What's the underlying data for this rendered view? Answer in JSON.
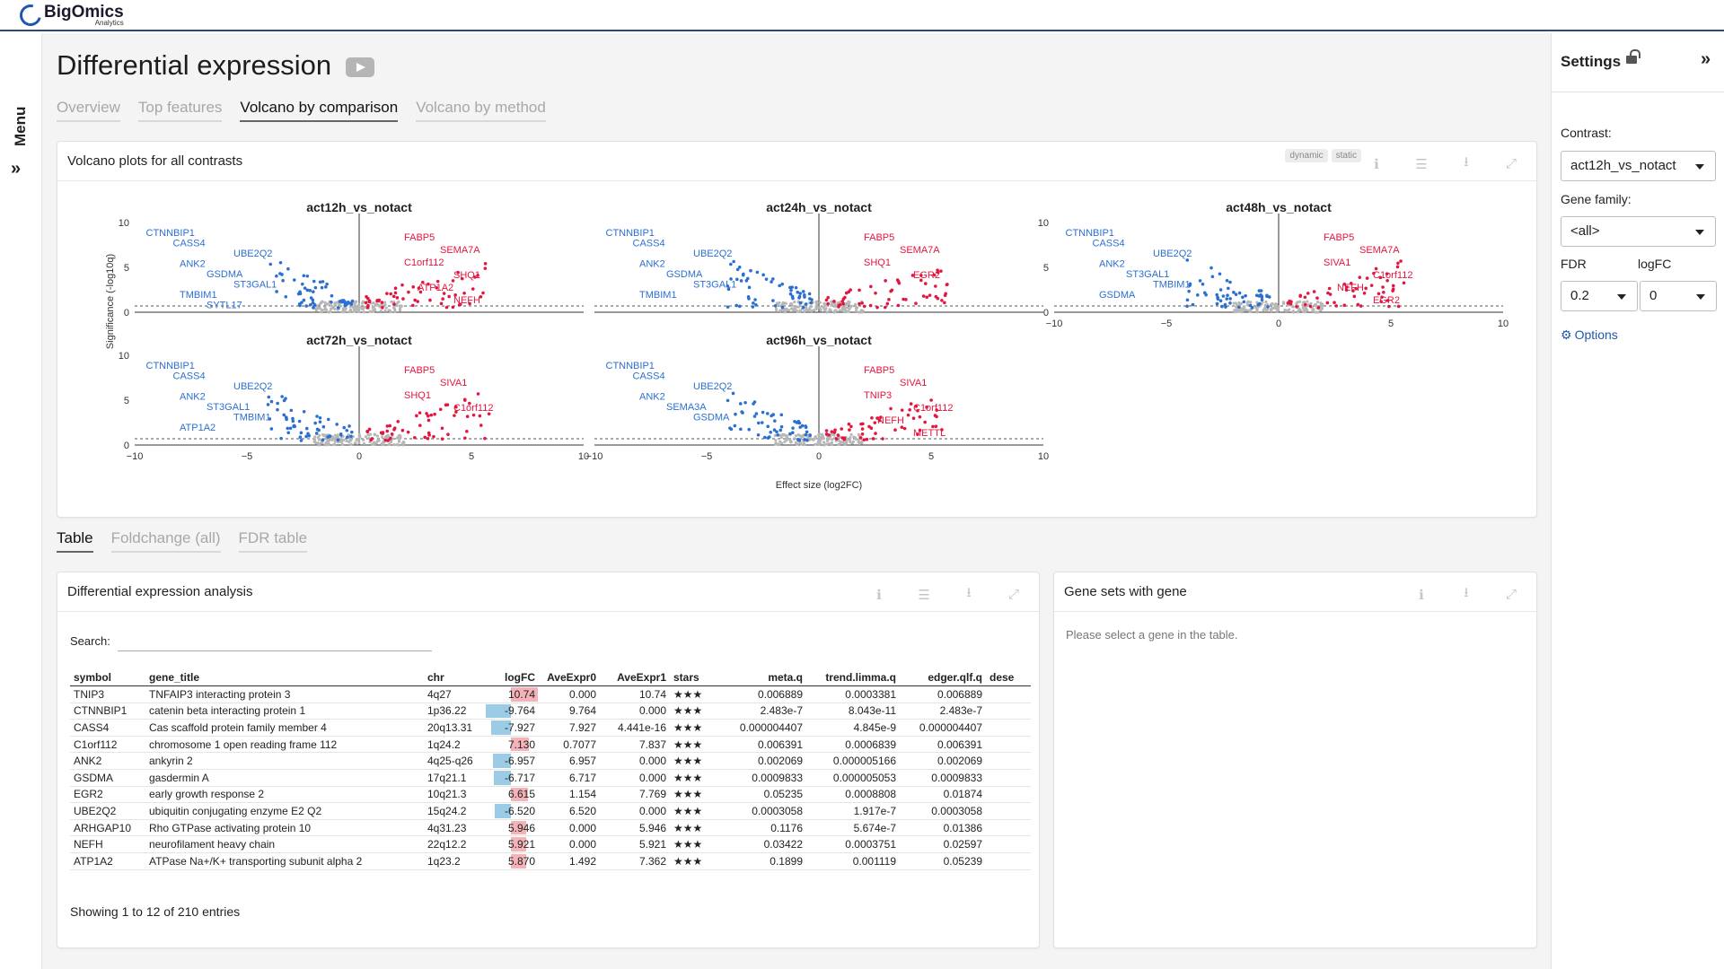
{
  "app": {
    "brand": "BigOmics",
    "brand_sub": "Analytics",
    "menu_label": "Menu"
  },
  "page": {
    "title": "Differential expression"
  },
  "tabs": [
    {
      "label": "Overview",
      "active": false
    },
    {
      "label": "Top features",
      "active": false
    },
    {
      "label": "Volcano by comparison",
      "active": true
    },
    {
      "label": "Volcano by method",
      "active": false
    }
  ],
  "volcano": {
    "title": "Volcano plots for all contrasts",
    "toggle": [
      "dynamic",
      "static"
    ],
    "ylabel": "Significance (-log10q)",
    "xlabel": "Effect size (log2FC)",
    "xticks": [
      "−10",
      "−5",
      "0",
      "5",
      "10"
    ],
    "yticks": [
      "0",
      "5",
      "10"
    ],
    "plots": [
      {
        "title": "act12h_vs_notact",
        "labels_left": [
          "CTNNBIP1",
          "CASS4",
          "UBE2Q2",
          "ANK2",
          "GSDMA",
          "ST3GAL1",
          "TMBIM1",
          "SYTL17"
        ],
        "labels_right": [
          "FABP5",
          "SEMA7A",
          "C1orf112",
          "SHQ1",
          "ATP1A2",
          "NEFH"
        ]
      },
      {
        "title": "act24h_vs_notact",
        "labels_left": [
          "CTNNBIP1",
          "CASS4",
          "UBE2Q2",
          "ANK2",
          "GSDMA",
          "ST3GAL1",
          "TMBIM1"
        ],
        "labels_right": [
          "FABP5",
          "SEMA7A",
          "SHQ1",
          "EGR2"
        ]
      },
      {
        "title": "act48h_vs_notact",
        "labels_left": [
          "CTNNBIP1",
          "CASS4",
          "UBE2Q2",
          "ANK2",
          "ST3GAL1",
          "TMBIM1",
          "GSDMA"
        ],
        "labels_right": [
          "FABP5",
          "SEMA7A",
          "SIVA1",
          "C1orf112",
          "NEFH",
          "EGR2"
        ]
      },
      {
        "title": "act72h_vs_notact",
        "labels_left": [
          "CTNNBIP1",
          "CASS4",
          "UBE2Q2",
          "ANK2",
          "ST3GAL1",
          "TMBIM1",
          "ATP1A2"
        ],
        "labels_right": [
          "FABP5",
          "SIVA1",
          "SHQ1",
          "C1orf112"
        ]
      },
      {
        "title": "act96h_vs_notact",
        "labels_left": [
          "CTNNBIP1",
          "CASS4",
          "UBE2Q2",
          "ANK2",
          "SEMA3A",
          "GSDMA"
        ],
        "labels_right": [
          "FABP5",
          "SIVA1",
          "TNIP3",
          "C1orf112",
          "NEFH",
          "METTL"
        ]
      }
    ]
  },
  "subtabs": [
    {
      "label": "Table",
      "active": true
    },
    {
      "label": "Foldchange (all)",
      "active": false
    },
    {
      "label": "FDR table",
      "active": false
    }
  ],
  "de_table": {
    "title": "Differential expression analysis",
    "search_label": "Search:",
    "search_value": "",
    "columns": [
      "symbol",
      "gene_title",
      "chr",
      "logFC",
      "AveExpr0",
      "AveExpr1",
      "stars",
      "meta.q",
      "trend.limma.q",
      "edger.qlf.q",
      "dese"
    ],
    "rows": [
      [
        "TNIP3",
        "TNFAIP3 interacting protein 3",
        "4q27",
        "10.74",
        "0.000",
        "10.74",
        "★★★",
        "0.006889",
        "0.0003381",
        "0.006889"
      ],
      [
        "CTNNBIP1",
        "catenin beta interacting protein 1",
        "1p36.22",
        "-9.764",
        "9.764",
        "0.000",
        "★★★",
        "2.483e-7",
        "8.043e-11",
        "2.483e-7"
      ],
      [
        "CASS4",
        "Cas scaffold protein family member 4",
        "20q13.31",
        "-7.927",
        "7.927",
        "4.441e-16",
        "★★★",
        "0.000004407",
        "4.845e-9",
        "0.000004407"
      ],
      [
        "C1orf112",
        "chromosome 1 open reading frame 112",
        "1q24.2",
        "7.130",
        "0.7077",
        "7.837",
        "★★★",
        "0.006391",
        "0.0006839",
        "0.006391"
      ],
      [
        "ANK2",
        "ankyrin 2",
        "4q25-q26",
        "-6.957",
        "6.957",
        "0.000",
        "★★★",
        "0.002069",
        "0.000005166",
        "0.002069"
      ],
      [
        "GSDMA",
        "gasdermin A",
        "17q21.1",
        "-6.717",
        "6.717",
        "0.000",
        "★★★",
        "0.0009833",
        "0.000005053",
        "0.0009833"
      ],
      [
        "EGR2",
        "early growth response 2",
        "10q21.3",
        "6.615",
        "1.154",
        "7.769",
        "★★★",
        "0.05235",
        "0.0008808",
        "0.01874"
      ],
      [
        "UBE2Q2",
        "ubiquitin conjugating enzyme E2 Q2",
        "15q24.2",
        "-6.520",
        "6.520",
        "0.000",
        "★★★",
        "0.0003058",
        "1.917e-7",
        "0.0003058"
      ],
      [
        "ARHGAP10",
        "Rho GTPase activating protein 10",
        "4q31.23",
        "5.946",
        "0.000",
        "5.946",
        "★★★",
        "0.1176",
        "5.674e-7",
        "0.01386"
      ],
      [
        "NEFH",
        "neurofilament heavy chain",
        "22q12.2",
        "5.921",
        "0.000",
        "5.921",
        "★★★",
        "0.03422",
        "0.0003751",
        "0.02597"
      ],
      [
        "ATP1A2",
        "ATPase Na+/K+ transporting subunit alpha 2",
        "1q23.2",
        "5.870",
        "1.492",
        "7.362",
        "★★★",
        "0.1899",
        "0.001119",
        "0.05239"
      ]
    ],
    "info": "Showing 1 to 12 of 210 entries"
  },
  "genesets": {
    "title": "Gene sets with gene",
    "message": "Please select a gene in the table."
  },
  "settings": {
    "title": "Settings",
    "contrast_label": "Contrast:",
    "contrast_value": "act12h_vs_notact",
    "family_label": "Gene family:",
    "family_value": "<all>",
    "fdr_label": "FDR",
    "fdr_value": "0.2",
    "logfc_label": "logFC",
    "logfc_value": "0",
    "options_label": "Options"
  },
  "colors": {
    "up": "#e3163f",
    "down": "#2b6fd1",
    "ns": "#b7b7b7",
    "accent": "#1e5aa8"
  }
}
